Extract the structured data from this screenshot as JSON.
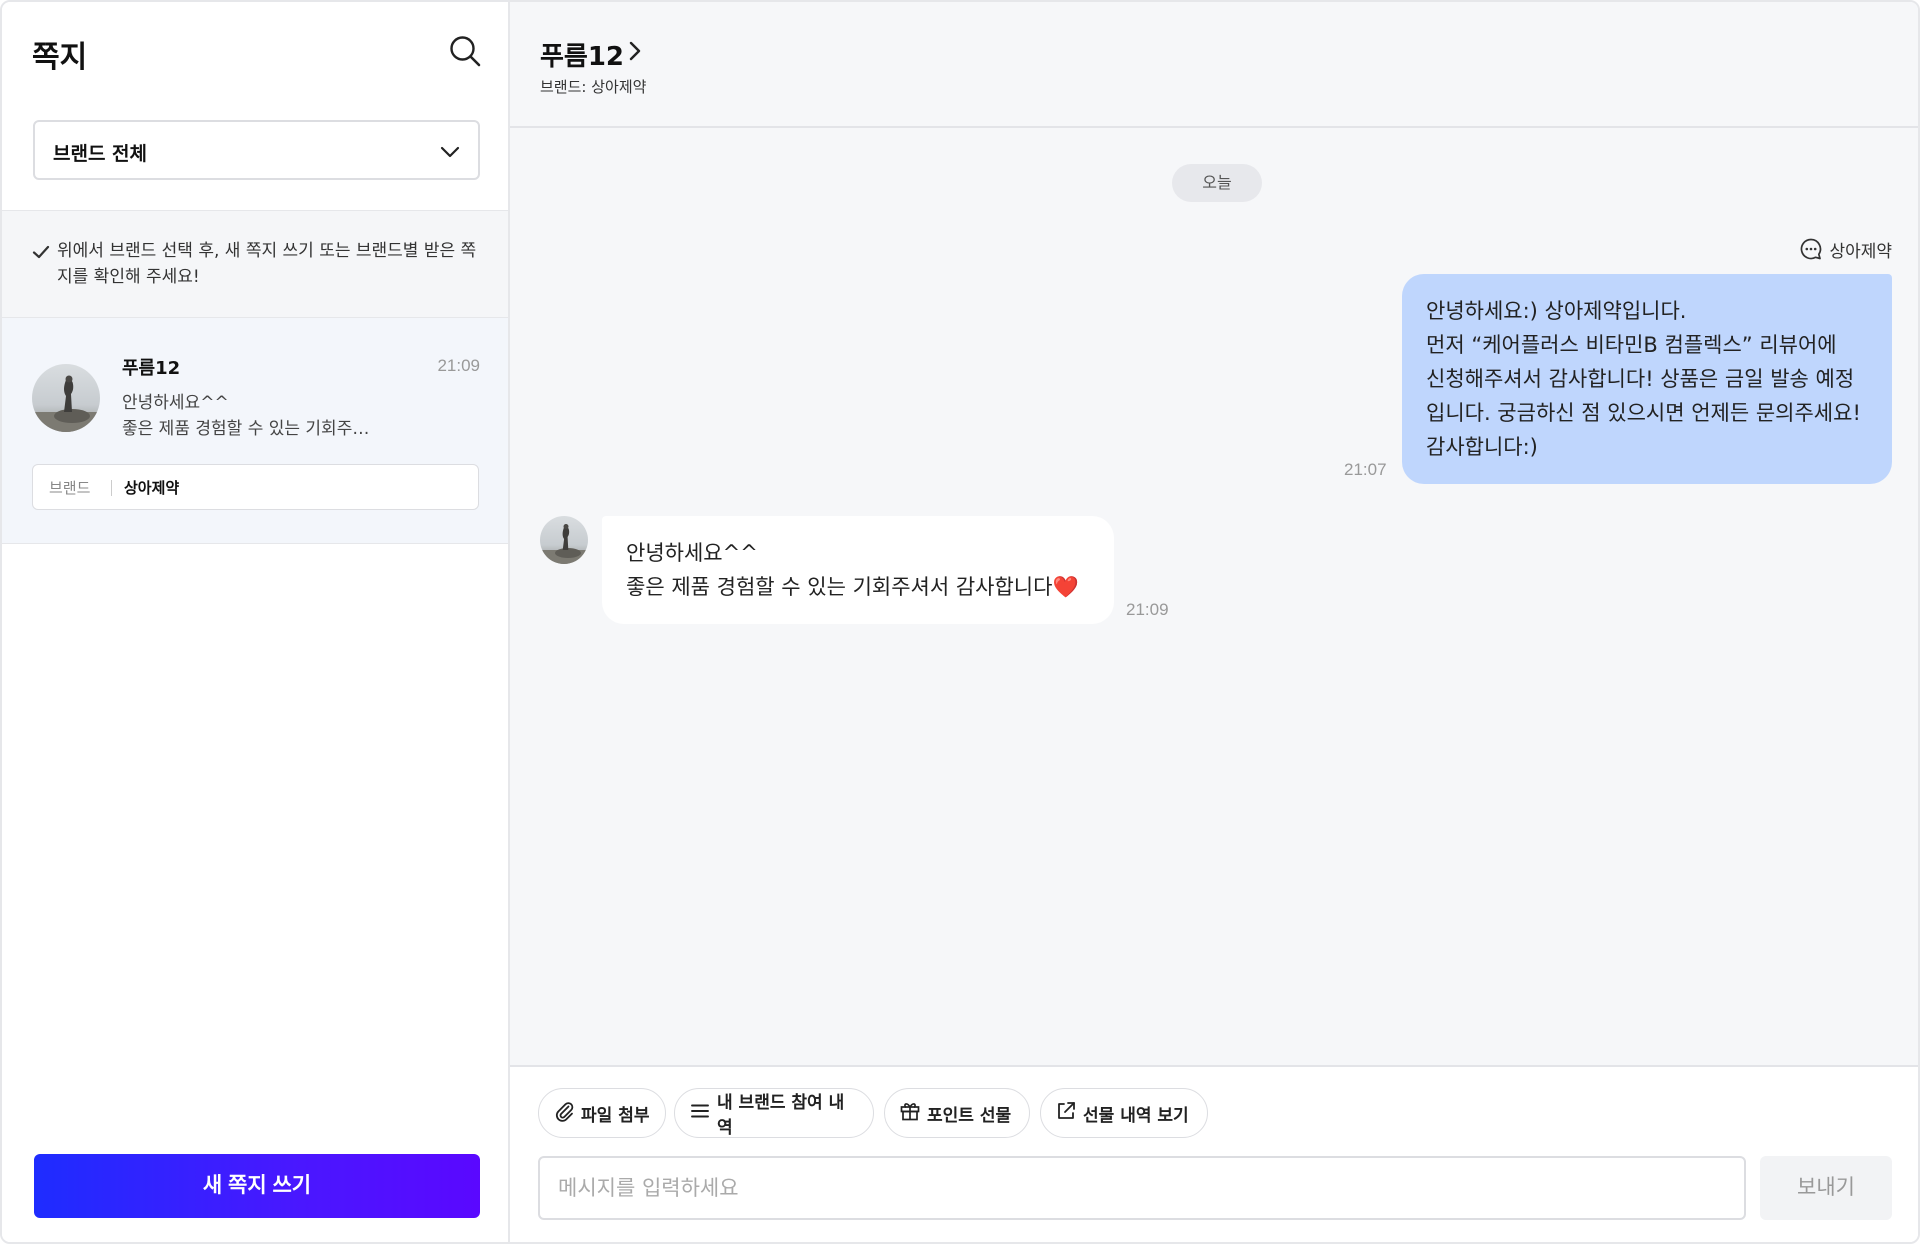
{
  "sidebar": {
    "title": "쪽지",
    "search_icon": "search-icon",
    "brand_filter": {
      "value": "브랜드 전체",
      "icon": "chevron-down-icon"
    },
    "notice": "위에서 브랜드 선택 후, 새 쪽지 쓰기 또는 브랜드별 받은 쪽지를 확인해 주세요!",
    "conversations": [
      {
        "name": "푸름12",
        "time": "21:09",
        "preview_line1": "안녕하세요^^",
        "preview_line2": "좋은 제품 경험할 수 있는 기회주…",
        "brand_label": "브랜드",
        "brand_value": "상아제약"
      }
    ],
    "new_message_button": "새 쪽지 쓰기"
  },
  "chat": {
    "header": {
      "name": "푸름12",
      "brand_line": "브랜드: 상아제약"
    },
    "day_separator": "오늘",
    "messages": [
      {
        "direction": "outgoing",
        "sender_label": "상아제약",
        "lines": [
          "안녕하세요:) 상아제약입니다.",
          "먼저 “케어플러스 비타민B 컴플렉스” 리뷰어에",
          "신청해주셔서 감사합니다! 상품은 금일 발송 예정",
          "입니다. 궁금하신 점 있으시면 언제든 문의주세요!",
          "감사합니다:)"
        ],
        "time": "21:07"
      },
      {
        "direction": "incoming",
        "lines": [
          "안녕하세요^^",
          "좋은 제품 경험할 수 있는 기회주셔서 감사합니다❤️"
        ],
        "time": "21:09"
      }
    ],
    "composer": {
      "actions": [
        {
          "label": "파일 첨부",
          "icon": "paperclip-icon"
        },
        {
          "label": "내 브랜드 참여 내역",
          "icon": "list-icon"
        },
        {
          "label": "포인트 선물",
          "icon": "gift-icon"
        },
        {
          "label": "선물 내역 보기",
          "icon": "external-link-icon"
        }
      ],
      "input_placeholder": "메시지를 입력하세요",
      "send_label": "보내기"
    }
  },
  "colors": {
    "primary_gradient_start": "#1e2cff",
    "primary_gradient_end": "#5a08ff",
    "outgoing_bubble": "#bfd6fd",
    "incoming_bubble": "#ffffff",
    "chat_background": "#f6f7f9",
    "selected_conversation": "#f3f6fb"
  }
}
